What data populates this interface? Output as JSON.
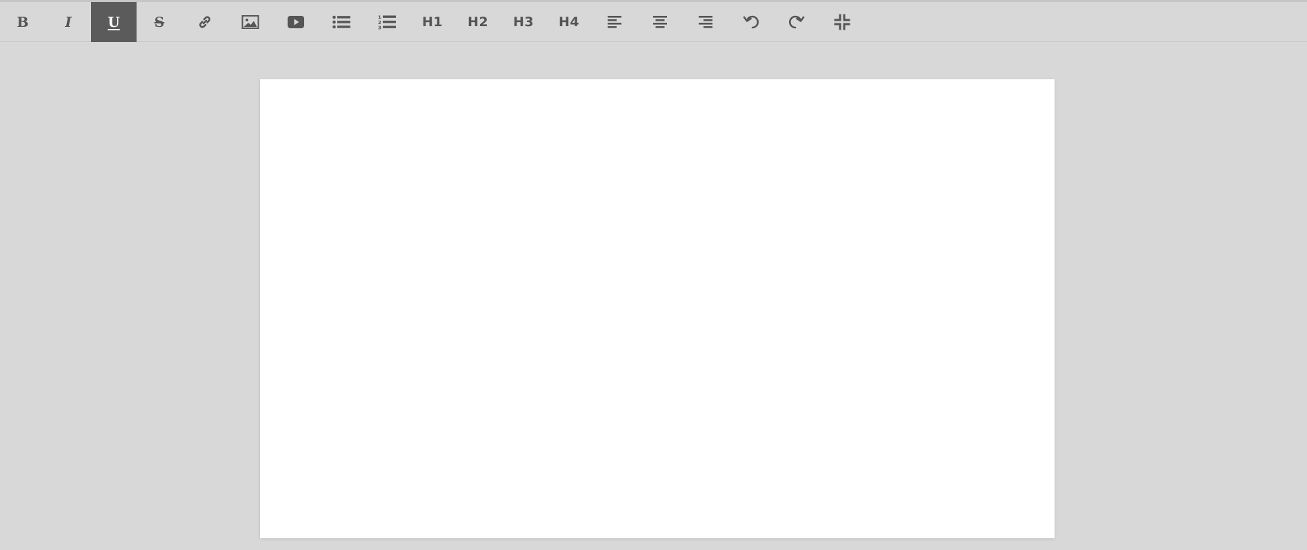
{
  "colors": {
    "background": "#d8d8d8",
    "toolbar_icon": "#555555",
    "active_button_bg": "#5b5b5b",
    "active_button_fg": "#ffffff",
    "editor_bg": "#ffffff"
  },
  "toolbar": {
    "bold_label": "B",
    "italic_label": "I",
    "underline_label": "U",
    "strikethrough_label": "S",
    "link_icon": "link-icon",
    "image_icon": "image-icon",
    "video_icon": "video-icon",
    "bullet_list_icon": "unordered-list-icon",
    "numbered_list_icon": "ordered-list-icon",
    "h1_label": "H1",
    "h2_label": "H2",
    "h3_label": "H3",
    "h4_label": "H4",
    "align_left_icon": "align-left-icon",
    "align_center_icon": "align-center-icon",
    "align_right_icon": "align-right-icon",
    "undo_icon": "undo-icon",
    "redo_icon": "redo-icon",
    "exit_fullscreen_icon": "compress-icon",
    "active_button": "underline"
  },
  "editor": {
    "content": ""
  }
}
